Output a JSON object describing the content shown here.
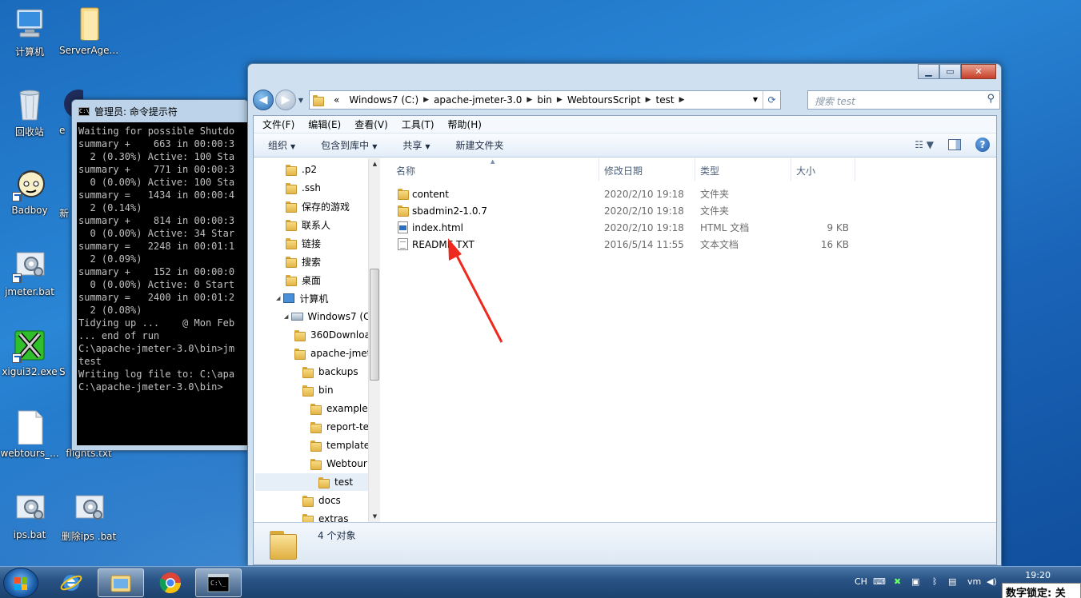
{
  "desktop": {
    "icons": [
      {
        "label": "计算机"
      },
      {
        "label": "ServerAge..."
      },
      {
        "label": "回收站"
      },
      {
        "label": "e"
      },
      {
        "label": "Badboy"
      },
      {
        "label": "新"
      },
      {
        "label": "jmeter.bat"
      },
      {
        "label": "xigui32.exe"
      },
      {
        "label": "S"
      },
      {
        "label": "webtours_..."
      },
      {
        "label": "flights.txt"
      },
      {
        "label": "ips.bat"
      },
      {
        "label": "删除ips .bat"
      }
    ]
  },
  "cmd": {
    "title": "管理员: 命令提示符",
    "lines": "Waiting for possible Shutdo\nsummary +    663 in 00:00:3\n  2 (0.30%) Active: 100 Sta\nsummary +    771 in 00:00:3\n  0 (0.00%) Active: 100 Sta\nsummary =   1434 in 00:00:4\n  2 (0.14%)\nsummary +    814 in 00:00:3\n  0 (0.00%) Active: 34 Star\nsummary =   2248 in 00:01:1\n  2 (0.09%)\nsummary +    152 in 00:00:0\n  0 (0.00%) Active: 0 Start\nsummary =   2400 in 00:01:2\n  2 (0.08%)\nTidying up ...    @ Mon Feb\n... end of run\nC:\\apache-jmeter-3.0\\bin>jm\ntest\nWriting log file to: C:\\apa\nC:\\apache-jmeter-3.0\\bin>"
  },
  "explorer": {
    "address": {
      "prefix": "«",
      "crumbs": [
        "Windows7 (C:)",
        "apache-jmeter-3.0",
        "bin",
        "WebtoursScript",
        "test"
      ]
    },
    "search_placeholder": "搜索 test",
    "menu": [
      "文件(F)",
      "编辑(E)",
      "查看(V)",
      "工具(T)",
      "帮助(H)"
    ],
    "toolbar": {
      "organize": "组织",
      "include_library": "包含到库中",
      "share": "共享",
      "new_folder": "新建文件夹"
    },
    "nav_tree": [
      {
        "label": ".p2"
      },
      {
        "label": ".ssh"
      },
      {
        "label": "保存的游戏"
      },
      {
        "label": "联系人"
      },
      {
        "label": "链接"
      },
      {
        "label": "搜索"
      },
      {
        "label": "桌面"
      },
      {
        "label": "计算机"
      },
      {
        "label": "Windows7 (C:"
      },
      {
        "label": "360Downloa"
      },
      {
        "label": "apache-jmet"
      },
      {
        "label": "backups"
      },
      {
        "label": "bin"
      },
      {
        "label": "example"
      },
      {
        "label": "report-te"
      },
      {
        "label": "template"
      },
      {
        "label": "Webtour"
      },
      {
        "label": "test"
      },
      {
        "label": "docs"
      },
      {
        "label": "extras"
      }
    ],
    "columns": {
      "name": "名称",
      "date": "修改日期",
      "type": "类型",
      "size": "大小"
    },
    "files": [
      {
        "name": "content",
        "date": "2020/2/10 19:18",
        "type": "文件夹",
        "size": ""
      },
      {
        "name": "sbadmin2-1.0.7",
        "date": "2020/2/10 19:18",
        "type": "文件夹",
        "size": ""
      },
      {
        "name": "index.html",
        "date": "2020/2/10 19:18",
        "type": "HTML 文档",
        "size": "9 KB"
      },
      {
        "name": "README.TXT",
        "date": "2016/5/14 11:55",
        "type": "文本文档",
        "size": "16 KB"
      }
    ],
    "status": "4 个对象"
  },
  "taskbar": {
    "tray": {
      "lang": "CH",
      "time": "19:20",
      "numlock": "数字锁定: 关"
    }
  },
  "colors": {
    "annotation_arrow": "#ee2a1e",
    "selection": "#e6eef8"
  }
}
